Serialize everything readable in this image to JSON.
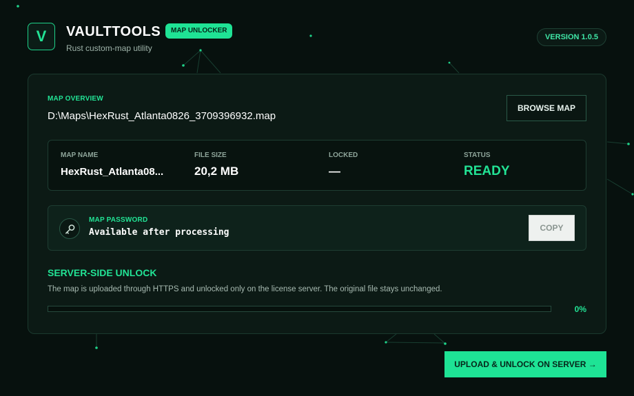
{
  "app": {
    "logo_letter": "V",
    "title": "VAULTTOOLS",
    "tag": "MAP UNLOCKER",
    "subtitle": "Rust custom-map utility",
    "version": "VERSION 1.0.5"
  },
  "overview": {
    "label": "MAP OVERVIEW",
    "path": "D:\\Maps\\HexRust_Atlanta0826_3709396932.map",
    "browse_label": "BROWSE MAP"
  },
  "info": {
    "map_name_label": "MAP NAME",
    "map_name_value": "HexRust_Atlanta08...",
    "file_size_label": "FILE SIZE",
    "file_size_value": "20,2 MB",
    "locked_label": "LOCKED",
    "locked_value": "—",
    "status_label": "STATUS",
    "status_value": "READY"
  },
  "password": {
    "label": "MAP PASSWORD",
    "value": "Available after processing",
    "copy_label": "COPY"
  },
  "unlock": {
    "title": "SERVER-SIDE UNLOCK",
    "description": "The map is uploaded through HTTPS and unlocked only on the license server. The original file stays unchanged.",
    "progress_percent": 0,
    "progress_text": "0%"
  },
  "actions": {
    "upload_label": "UPLOAD & UNLOCK ON SERVER →"
  },
  "icons": {
    "password": "key-icon"
  },
  "colors": {
    "accent": "#1fe395",
    "background": "#07110e",
    "panel": "#0c1a15",
    "status_ready": "#22e395"
  }
}
